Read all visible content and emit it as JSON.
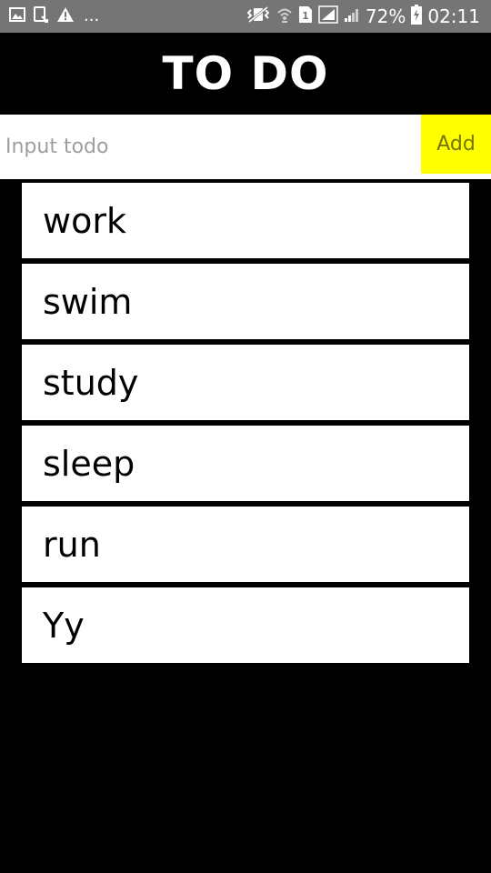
{
  "status_bar": {
    "overflow_indicator": "...",
    "battery_percent": "72%",
    "time": "02:11",
    "sim_slot": "1",
    "icons_left": [
      "image-icon",
      "tablet-icon",
      "warning-icon"
    ],
    "icons_right": [
      "vibrate-icon",
      "wifi-icon",
      "sim-icon",
      "signal-icon",
      "signal-icon",
      "battery-charging-icon"
    ]
  },
  "header": {
    "title": "TO DO"
  },
  "todo_input": {
    "placeholder": "Input todo",
    "value": ""
  },
  "add_button": {
    "label": "Add",
    "color": "#ffff00"
  },
  "todos": [
    {
      "text": "work"
    },
    {
      "text": "swim"
    },
    {
      "text": "study"
    },
    {
      "text": "sleep"
    },
    {
      "text": "run"
    },
    {
      "text": "Yy"
    }
  ],
  "colors": {
    "background": "#000000",
    "status_bar": "#757575",
    "item_background": "#ffffff"
  }
}
